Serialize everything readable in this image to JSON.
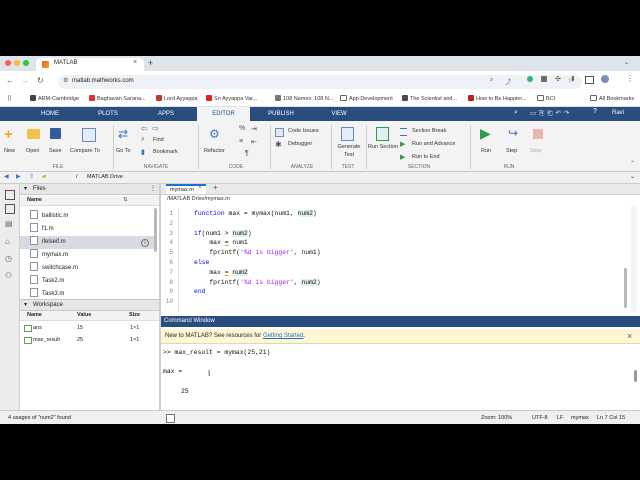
{
  "browser": {
    "tab_title": "MATLAB",
    "url": "matlab.mathworks.com",
    "profile": "Ravi",
    "bookmarks": [
      "ARM-Cambridge",
      "Baghavan Sarana...",
      "Lord Ayyappa",
      "Sri Ayyappa Var...",
      "108 Names: 108 N...",
      "App Development",
      "The Scientist and...",
      "How to Be Happier...",
      "BCI"
    ],
    "all_bookmarks": "All Bookmarks"
  },
  "matlab_tabs": [
    "HOME",
    "PLOTS",
    "APPS",
    "EDITOR",
    "PUBLISH",
    "VIEW"
  ],
  "toolstrip": {
    "new": "New",
    "open": "Open",
    "save": "Save",
    "compare": "Compare To",
    "file_section": "FILE",
    "goto": "Go To",
    "find": "Find",
    "bookmark": "Bookmark",
    "navigate_section": "NAVIGATE",
    "refactor": "Refactor",
    "code_section": "CODE",
    "code_issues": "Code Issues",
    "debugger": "Debugger",
    "analyze_section": "ANALYZE",
    "generate_test": "Generate Test",
    "test_section": "TEST",
    "run_section_btn": "Run Section",
    "section_break": "Section Break",
    "run_and_advance": "Run and Advance",
    "run_to_end": "Run to End",
    "section_section": "SECTION",
    "run": "Run",
    "step": "Step",
    "stop": "Stop",
    "run_section": "RUN"
  },
  "path": {
    "sep": "/",
    "folder": "MATLAB Drive"
  },
  "files_panel": {
    "title": "Files",
    "col_name": "Name",
    "items": [
      "ballistic.m",
      "f1.m",
      "ifelseif.m",
      "mymax.m",
      "switchcase.m",
      "Task2.m",
      "Task3.m"
    ]
  },
  "workspace": {
    "title": "Workspace",
    "col_name": "Name",
    "col_value": "Value",
    "col_size": "Size",
    "rows": [
      {
        "name": "ans",
        "value": "15",
        "size": "1×1"
      },
      {
        "name": "max_result",
        "value": "25",
        "size": "1×1"
      }
    ]
  },
  "editor": {
    "tab": "mymax.m",
    "file_path": "/MATLAB Drive/mymax.m",
    "line_numbers": [
      "1",
      "2",
      "3",
      "4",
      "5",
      "6",
      "7",
      "8",
      "9",
      "10"
    ]
  },
  "command_window": {
    "title": "Command Window",
    "banner_prefix": "New to MATLAB? See resources for ",
    "banner_link": "Getting Started",
    "banner_suffix": ".",
    "command": ">> max_result = mymax(25,21)",
    "out_label": "max =",
    "out_value": "25"
  },
  "status": {
    "left": "4 usages of \"num2\" found",
    "zoom": "Zoom: 100%",
    "encoding": "UTF-8",
    "eol": "LF",
    "func": "mymax",
    "pos": "Ln 7  Col 15"
  },
  "colors": {
    "matlab_blue": "#2a4d7f",
    "accent": "#1d6fd1",
    "banner": "#fff6d5"
  }
}
